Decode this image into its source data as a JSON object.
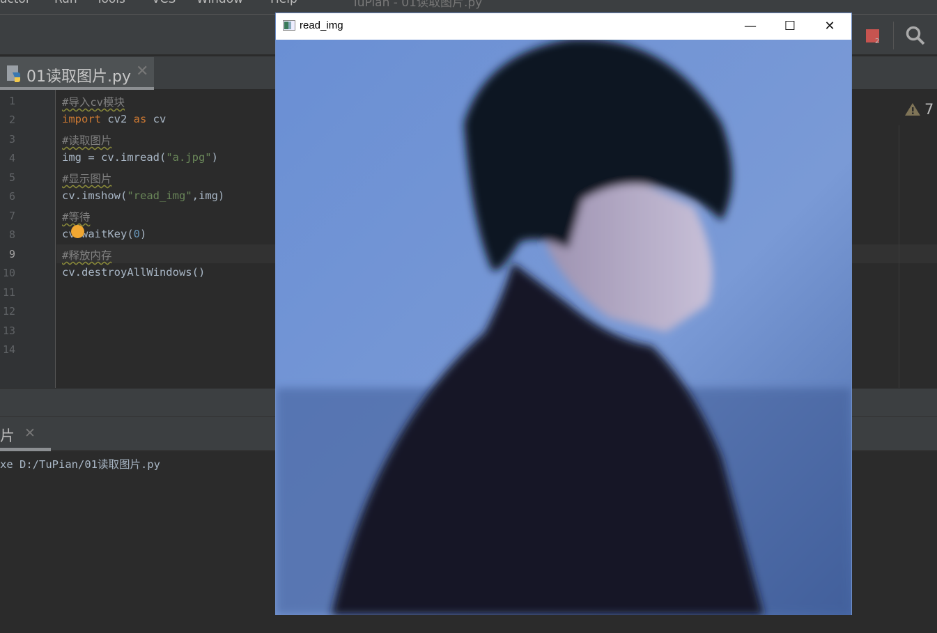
{
  "ide": {
    "menu": [
      "actor",
      "Run",
      "Tools",
      "VCS",
      "Window",
      "Help"
    ],
    "title": "TuPian - 01读取图片.py",
    "file_tab": {
      "label": "01读取图片.py",
      "icon": "python-file-icon"
    },
    "notification_count": "2",
    "warning_count": "7",
    "line_numbers": [
      "1",
      "2",
      "3",
      "4",
      "5",
      "6",
      "7",
      "8",
      "9",
      "10",
      "11",
      "12",
      "13",
      "14"
    ],
    "code": {
      "l1": "#导入cv模块",
      "l2_kw": "import",
      "l2_a": " cv2 ",
      "l2_kw2": "as",
      "l2_b": " cv",
      "l3": "#读取图片",
      "l4_a": "img = cv.imread(",
      "l4_s": "\"a.jpg\"",
      "l4_b": ")",
      "l5": "#显示图片",
      "l6_a": "cv.imshow(",
      "l6_s": "\"read_img\"",
      "l6_b": ",img)",
      "l7": "#等待",
      "l8_a": "cv.waitKey(",
      "l8_n": "0",
      "l8_b": ")",
      "l9": "#释放内存",
      "l10": "cv.destroyAllWindows()"
    },
    "run_tab": "片",
    "console_line": "xe D:/TuPian/01读取图片.py"
  },
  "image_window": {
    "title": "read_img",
    "minimize": "—",
    "maximize": "☐",
    "close": "✕"
  },
  "colors": {
    "accent": "#cc7832",
    "string": "#6a8759",
    "number": "#6897bb",
    "stop": "#c75450"
  }
}
